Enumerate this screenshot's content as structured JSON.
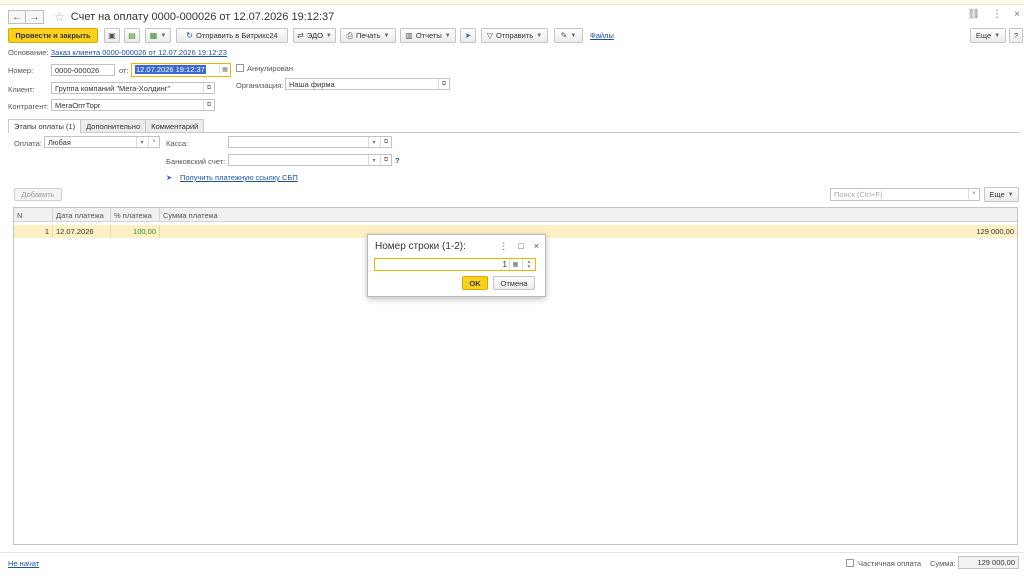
{
  "window": {
    "title": "Счет на оплату 0000-000026 от 12.07.2026 19:12:37",
    "back_icon": "←",
    "forward_icon": "→",
    "star_icon": "☆",
    "link_icon": "🔗",
    "more_icon": "⋮",
    "close_icon": "×"
  },
  "toolbar": {
    "post_close": "Провести и закрыть",
    "send_bitrix": "Отправить в Битрикс24",
    "edo": "ЭДО",
    "print": "Печать",
    "reports": "Отчеты",
    "send": "Отправить",
    "files": "Файлы",
    "more": "Еще",
    "help": "?"
  },
  "basis": {
    "label": "Основание:",
    "link": "Заказ клиента 0000-000026 от 12.07.2026 19:12:23"
  },
  "form": {
    "number_label": "Номер:",
    "number_value": "0000-000026",
    "from_label": "от:",
    "date_value": "12.07.2026 19:12:37",
    "annulled_label": "Аннулирован",
    "client_label": "Клиент:",
    "client_value": "Группа компаний \"Мега-Холдинг\"",
    "org_label": "Организация:",
    "org_value": "Наша фирма",
    "counterparty_label": "Контрагент:",
    "counterparty_value": "МегаОптТорг"
  },
  "tabs": [
    {
      "label": "Этапы оплаты (1)"
    },
    {
      "label": "Дополнительно"
    },
    {
      "label": "Комментарий"
    }
  ],
  "payment": {
    "payment_label": "Оплата:",
    "payment_value": "Любая",
    "cash_label": "Касса:",
    "bank_label": "Банковский счет:",
    "sbp_link": "Получить платежную ссылку СБП",
    "help": "?"
  },
  "table_toolbar": {
    "add": "Добавить",
    "search_placeholder": "Поиск (Ctrl+F)",
    "more": "Еще"
  },
  "table": {
    "columns": [
      "N",
      "Дата платежа",
      "% платежа",
      "Сумма платежа"
    ],
    "rows": [
      {
        "n": "1",
        "date": "12.07.2026",
        "percent": "100,00",
        "amount": "129 000,00"
      }
    ]
  },
  "dialog": {
    "title": "Номер строки (1-2):",
    "value": "1",
    "ok": "OK",
    "cancel": "Отмена"
  },
  "footer": {
    "status_link": "Не начат",
    "partial_label": "Частичная оплата",
    "sum_label": "Сумма:",
    "sum_value": "129 000,00"
  },
  "colors": {
    "accent_yellow": "#fbd11d",
    "row_highlight": "#fcf0c4",
    "link_blue": "#1a52a5"
  }
}
